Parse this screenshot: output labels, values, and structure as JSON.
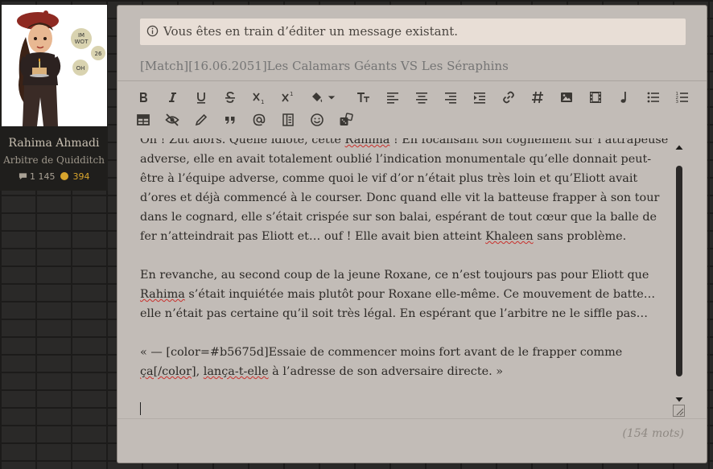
{
  "profile": {
    "name": "Rahima Ahmadi",
    "role": "Arbitre de Quidditch",
    "messages_count": "1 145",
    "gold_count": "394",
    "avatar_bubbles": [
      "IM WOT",
      "26",
      "OH"
    ]
  },
  "editor": {
    "info_message": "Vous êtes en train d’éditer un message existant.",
    "subject_placeholder": "[Match][16.06.2051]Les Calamars Géants VS Les Séraphins",
    "toolbar_row1": [
      "bold-icon",
      "italic-icon",
      "underline-icon",
      "strikethrough-icon",
      "subscript-icon",
      "superscript-icon",
      "paint-bucket-icon",
      "dropdown-caret-icon",
      "text-size-icon",
      "align-left-icon",
      "align-center-icon",
      "align-right-icon",
      "indent-icon",
      "link-icon",
      "hashtag-icon",
      "image-icon",
      "video-icon",
      "music-icon",
      "bullet-list-icon",
      "numbered-list-icon"
    ],
    "toolbar_row2": [
      "table-icon",
      "eye-slash-icon",
      "pencil-icon",
      "quote-icon",
      "at-sign-icon",
      "spoiler-icon",
      "emoji-icon",
      "dice-icon"
    ],
    "content": {
      "p1_a": "Oh ! Zut alors. Quelle idiote, cette ",
      "p1_name": "Rahima",
      "p1_b": " ! En focalisant son cognement sur l’attrapeuse ad­verse, elle en avait totalement oublié l’indication monumentale qu’elle donnait peut-être à l’équipe adverse, comme quoi le vif d’or n’était plus très loin et qu’Eliott avait d’ores et déjà commencé à le courser. Donc quand elle vit la batteuse frapper à son tour dans le cognard, elle s’était crispée sur son balai, espérant de tout cœur que la balle de fer n’atteindrait pas Eliott et… ouf ! Elle avait bien atteint ",
      "p1_khaleen": "Khaleen",
      "p1_c": " sans problème.",
      "p2_a": "En revanche, au second coup de la jeune Roxane, ce n’est toujours pas pour Eliott que ",
      "p2_name": "Rahima",
      "p2_b": " s’était inquiétée mais plutôt pour Roxane elle-même. Ce mouvement de batte… elle n’était pas certaine qu’il soit très légal. En espérant que l’arbitre ne le siffle pas…",
      "p3_a": "« — [color=#b5675d]Essaie de commencer moins fort avant de le frapper comme ",
      "p3_tag": "ça[/color]",
      "p3_b": ", ",
      "p3_lanca": "lança-t-elle",
      "p3_c": " à l’adresse de son adversaire directe. »"
    },
    "word_count": "(154 mots)"
  },
  "colors": {
    "panel_bg": "#c2bcb7",
    "info_bg": "#e8ded6",
    "gold": "#d8a52d",
    "spellcheck": "#c9302c"
  }
}
